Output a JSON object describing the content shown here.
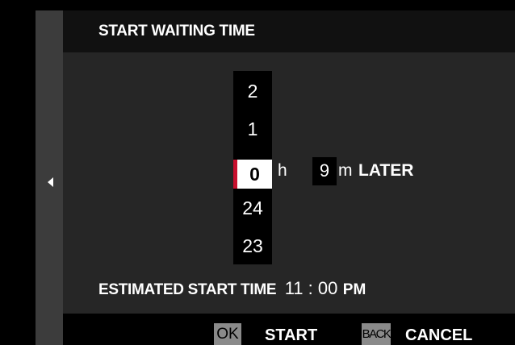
{
  "header": {
    "title": "START WAITING TIME"
  },
  "left_rail": {
    "arrow_icon": "triangle-left-icon"
  },
  "hour_picker": {
    "values_above": [
      "2",
      "1"
    ],
    "selected": "0",
    "values_below": [
      "24",
      "23"
    ],
    "unit": "h",
    "accent_color": "#c8102e"
  },
  "minute_picker": {
    "value": "9",
    "unit": "m"
  },
  "later_label": "LATER",
  "estimate": {
    "label": "ESTIMATED START TIME",
    "time": "11 : 00",
    "ampm": "PM"
  },
  "footer": {
    "ok_key": "OK",
    "start_label": "START",
    "back_key": "BACK",
    "cancel_label": "CANCEL"
  }
}
